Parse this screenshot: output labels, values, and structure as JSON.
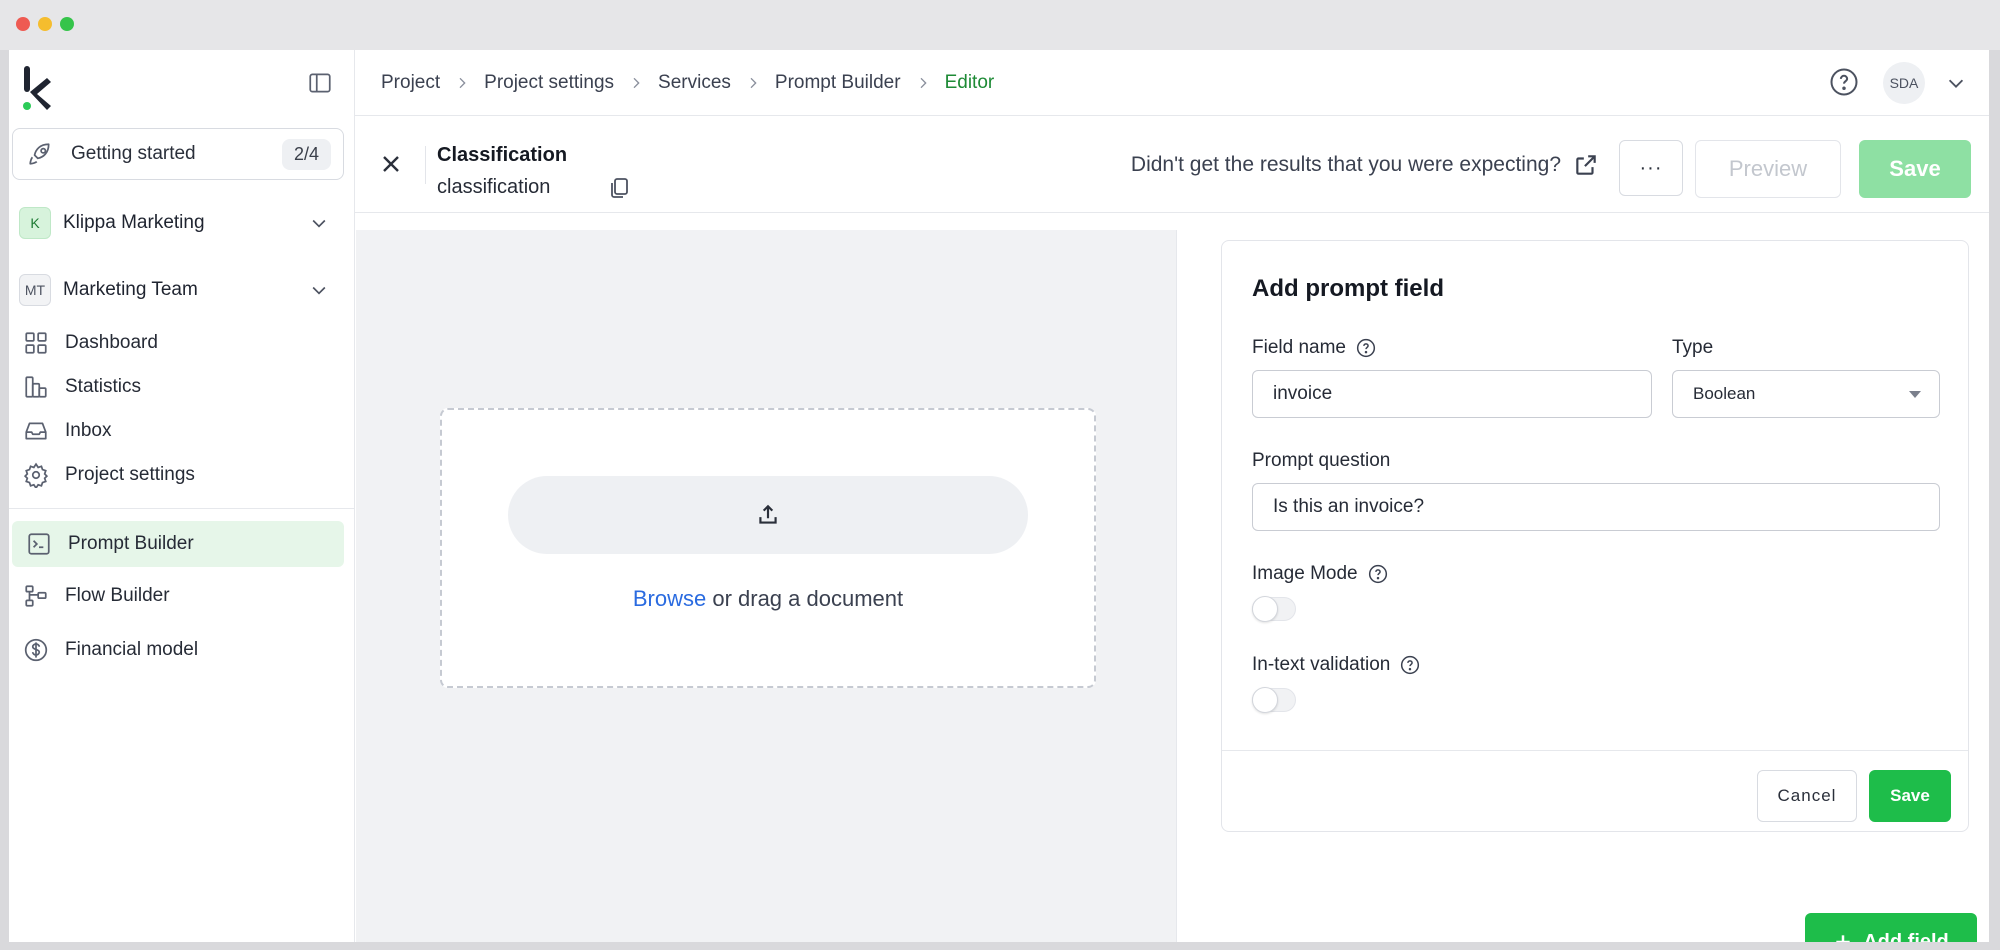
{
  "sidebar": {
    "getting_started": {
      "label": "Getting started",
      "count": "2/4"
    },
    "orgs": [
      {
        "initials": "K",
        "label": "Klippa Marketing"
      },
      {
        "initials": "MT",
        "label": "Marketing Team"
      }
    ],
    "nav": [
      {
        "label": "Dashboard",
        "icon": "dashboard-icon"
      },
      {
        "label": "Statistics",
        "icon": "statistics-icon"
      },
      {
        "label": "Inbox",
        "icon": "inbox-icon"
      },
      {
        "label": "Project settings",
        "icon": "gear-icon"
      }
    ],
    "tools": [
      {
        "label": "Prompt Builder",
        "icon": "terminal-icon",
        "active": true
      },
      {
        "label": "Flow Builder",
        "icon": "flow-icon"
      },
      {
        "label": "Financial model",
        "icon": "dollar-icon"
      }
    ]
  },
  "header": {
    "breadcrumbs": [
      "Project",
      "Project settings",
      "Services",
      "Prompt Builder",
      "Editor"
    ],
    "user_initials": "SDA"
  },
  "subheader": {
    "title": "Classification",
    "subtitle": "classification",
    "feedback_text": "Didn't get the results that you were expecting?",
    "more_label": "···",
    "preview_label": "Preview",
    "save_label": "Save"
  },
  "upload": {
    "browse_label": "Browse",
    "rest_label": " or drag a document"
  },
  "form": {
    "title": "Add prompt field",
    "field_name_label": "Field name",
    "field_name_value": "invoice",
    "type_label": "Type",
    "type_value": "Boolean",
    "prompt_question_label": "Prompt question",
    "prompt_question_value": "Is this an invoice?",
    "image_mode_label": "Image Mode",
    "image_mode_on": false,
    "in_text_validation_label": "In-text validation",
    "in_text_validation_on": false,
    "cancel_label": "Cancel",
    "save_label": "Save"
  },
  "add_field_label": "Add field",
  "colors": {
    "accent_green": "#1ebd4a",
    "active_nav_bg": "#e6f6e9",
    "link_blue": "#2a6be0",
    "breadcrumb_current": "#1d8a35"
  }
}
